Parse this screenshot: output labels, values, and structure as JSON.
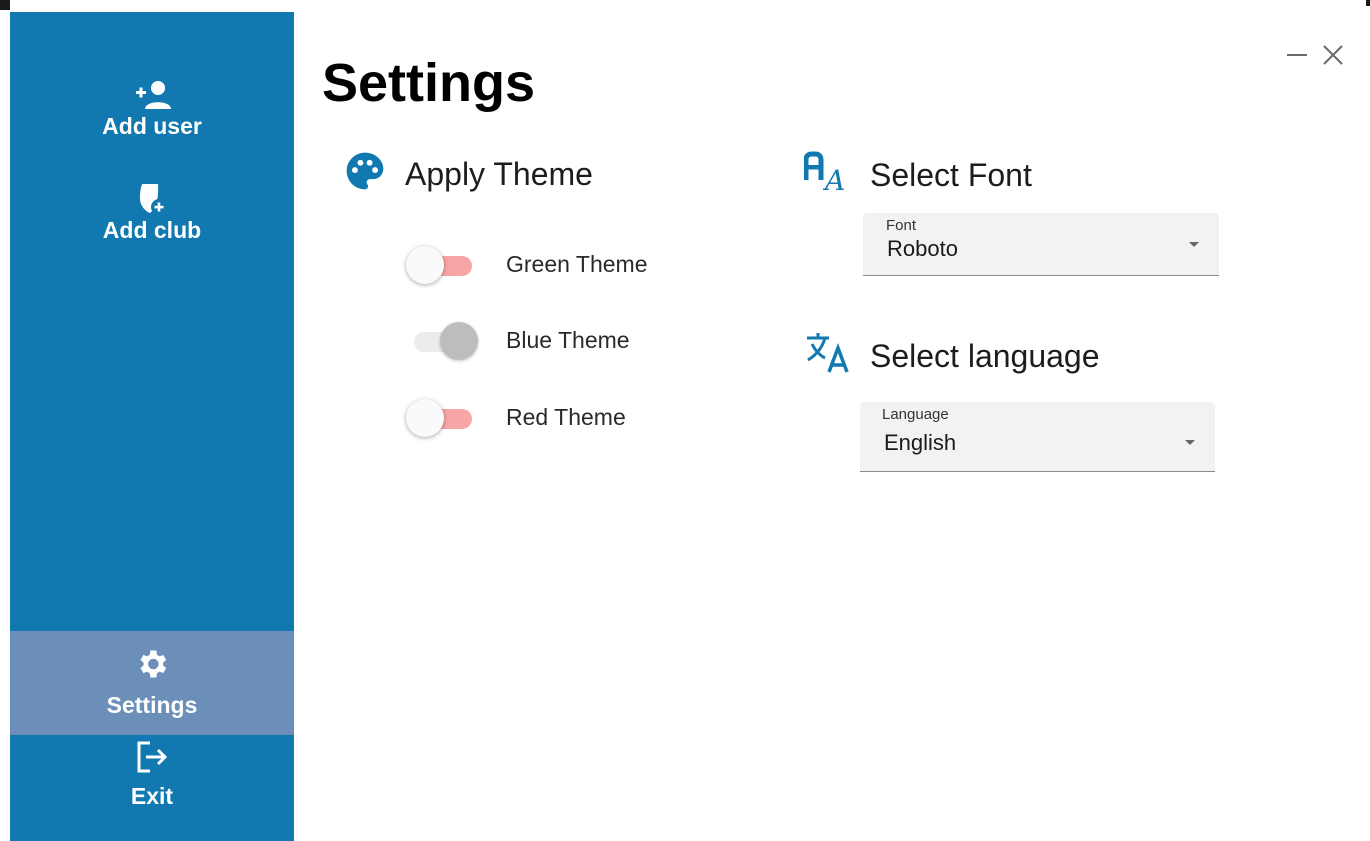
{
  "sidebar": {
    "items": [
      {
        "label": "Add user",
        "icon": "add-user-icon"
      },
      {
        "label": "Add club",
        "icon": "add-club-shield-icon"
      },
      {
        "label": "Settings",
        "icon": "gear-icon",
        "active": true
      },
      {
        "label": "Exit",
        "icon": "exit-icon"
      }
    ],
    "background": "#1179b0",
    "active_background": "#6b8fb8"
  },
  "window": {
    "minimize_icon": "minimize-icon",
    "close_icon": "close-icon"
  },
  "page": {
    "title": "Settings"
  },
  "theme_section": {
    "label": "Apply Theme",
    "icon": "palette-icon",
    "options": [
      {
        "label": "Green Theme",
        "checked": false
      },
      {
        "label": "Blue Theme",
        "checked": true
      },
      {
        "label": "Red Theme",
        "checked": false
      }
    ]
  },
  "font_section": {
    "label": "Select Font",
    "icon": "font-icon",
    "field_caption": "Font",
    "value": "Roboto"
  },
  "language_section": {
    "label": "Select language",
    "icon": "translate-icon",
    "field_caption": "Language",
    "value": "English"
  },
  "colors": {
    "accent": "#1179b0",
    "toggle_off_track": "#f7a5a5"
  }
}
